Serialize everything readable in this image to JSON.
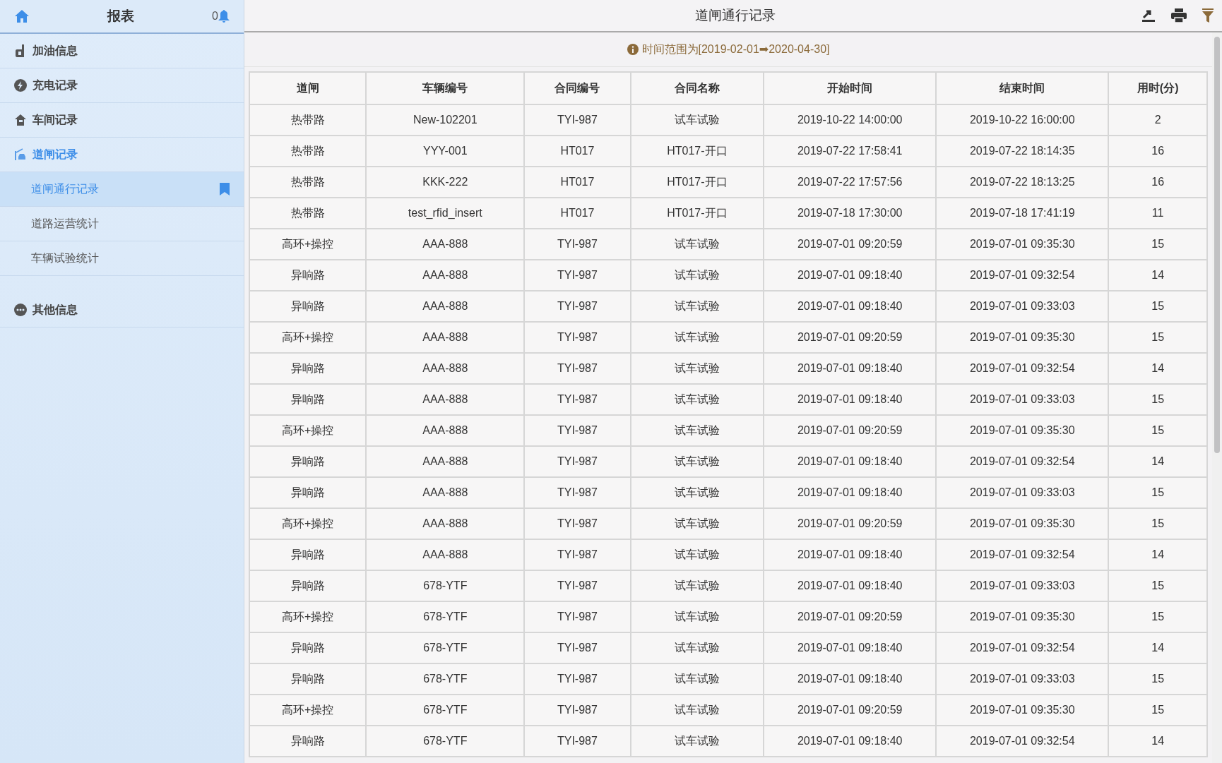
{
  "sidebar": {
    "title": "报表",
    "notification_count": "0",
    "groups": [
      {
        "label": "加油信息",
        "active": false
      },
      {
        "label": "充电记录",
        "active": false
      },
      {
        "label": "车间记录",
        "active": false
      },
      {
        "label": "道闸记录",
        "active": true,
        "children": [
          {
            "label": "道闸通行记录",
            "selected": true
          },
          {
            "label": "道路运营统计",
            "selected": false
          },
          {
            "label": "车辆试验统计",
            "selected": false
          }
        ]
      },
      {
        "label": "其他信息",
        "active": false
      }
    ]
  },
  "header": {
    "title": "道闸通行记录"
  },
  "notice": "时间范围为[2019-02-01➡2020-04-30]",
  "table": {
    "columns": [
      "道闸",
      "车辆编号",
      "合同编号",
      "合同名称",
      "开始时间",
      "结束时间",
      "用时(分)"
    ],
    "rows": [
      [
        "热带路",
        "New-102201",
        "TYI-987",
        "试车试验",
        "2019-10-22 14:00:00",
        "2019-10-22 16:00:00",
        "2"
      ],
      [
        "热带路",
        "YYY-001",
        "HT017",
        "HT017-开口",
        "2019-07-22 17:58:41",
        "2019-07-22 18:14:35",
        "16"
      ],
      [
        "热带路",
        "KKK-222",
        "HT017",
        "HT017-开口",
        "2019-07-22 17:57:56",
        "2019-07-22 18:13:25",
        "16"
      ],
      [
        "热带路",
        "test_rfid_insert",
        "HT017",
        "HT017-开口",
        "2019-07-18 17:30:00",
        "2019-07-18 17:41:19",
        "11"
      ],
      [
        "高环+操控",
        "AAA-888",
        "TYI-987",
        "试车试验",
        "2019-07-01 09:20:59",
        "2019-07-01 09:35:30",
        "15"
      ],
      [
        "异响路",
        "AAA-888",
        "TYI-987",
        "试车试验",
        "2019-07-01 09:18:40",
        "2019-07-01 09:32:54",
        "14"
      ],
      [
        "异响路",
        "AAA-888",
        "TYI-987",
        "试车试验",
        "2019-07-01 09:18:40",
        "2019-07-01 09:33:03",
        "15"
      ],
      [
        "高环+操控",
        "AAA-888",
        "TYI-987",
        "试车试验",
        "2019-07-01 09:20:59",
        "2019-07-01 09:35:30",
        "15"
      ],
      [
        "异响路",
        "AAA-888",
        "TYI-987",
        "试车试验",
        "2019-07-01 09:18:40",
        "2019-07-01 09:32:54",
        "14"
      ],
      [
        "异响路",
        "AAA-888",
        "TYI-987",
        "试车试验",
        "2019-07-01 09:18:40",
        "2019-07-01 09:33:03",
        "15"
      ],
      [
        "高环+操控",
        "AAA-888",
        "TYI-987",
        "试车试验",
        "2019-07-01 09:20:59",
        "2019-07-01 09:35:30",
        "15"
      ],
      [
        "异响路",
        "AAA-888",
        "TYI-987",
        "试车试验",
        "2019-07-01 09:18:40",
        "2019-07-01 09:32:54",
        "14"
      ],
      [
        "异响路",
        "AAA-888",
        "TYI-987",
        "试车试验",
        "2019-07-01 09:18:40",
        "2019-07-01 09:33:03",
        "15"
      ],
      [
        "高环+操控",
        "AAA-888",
        "TYI-987",
        "试车试验",
        "2019-07-01 09:20:59",
        "2019-07-01 09:35:30",
        "15"
      ],
      [
        "异响路",
        "AAA-888",
        "TYI-987",
        "试车试验",
        "2019-07-01 09:18:40",
        "2019-07-01 09:32:54",
        "14"
      ],
      [
        "异响路",
        "678-YTF",
        "TYI-987",
        "试车试验",
        "2019-07-01 09:18:40",
        "2019-07-01 09:33:03",
        "15"
      ],
      [
        "高环+操控",
        "678-YTF",
        "TYI-987",
        "试车试验",
        "2019-07-01 09:20:59",
        "2019-07-01 09:35:30",
        "15"
      ],
      [
        "异响路",
        "678-YTF",
        "TYI-987",
        "试车试验",
        "2019-07-01 09:18:40",
        "2019-07-01 09:32:54",
        "14"
      ],
      [
        "异响路",
        "678-YTF",
        "TYI-987",
        "试车试验",
        "2019-07-01 09:18:40",
        "2019-07-01 09:33:03",
        "15"
      ],
      [
        "高环+操控",
        "678-YTF",
        "TYI-987",
        "试车试验",
        "2019-07-01 09:20:59",
        "2019-07-01 09:35:30",
        "15"
      ],
      [
        "异响路",
        "678-YTF",
        "TYI-987",
        "试车试验",
        "2019-07-01 09:18:40",
        "2019-07-01 09:32:54",
        "14"
      ]
    ]
  }
}
